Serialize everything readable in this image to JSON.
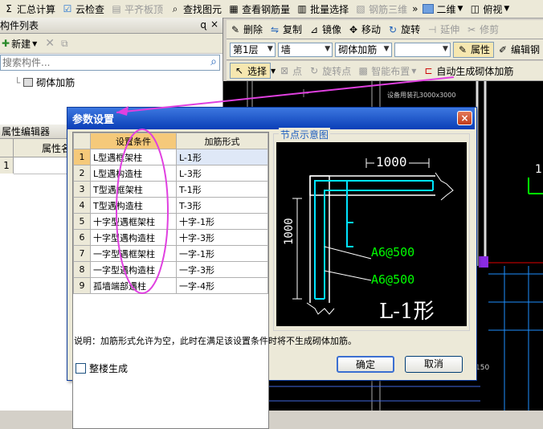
{
  "toolbar1": {
    "items": [
      {
        "label": "汇总计算",
        "icon": "sigma-icon",
        "enabled": true
      },
      {
        "label": "云检查",
        "icon": "cloud-check-icon",
        "enabled": true
      },
      {
        "label": "平齐板顶",
        "icon": "align-slab-icon",
        "enabled": false
      },
      {
        "label": "查找图元",
        "icon": "find-icon",
        "enabled": true
      },
      {
        "label": "查看钢筋量",
        "icon": "rebar-view-icon",
        "enabled": true
      },
      {
        "label": "批量选择",
        "icon": "batch-select-icon",
        "enabled": true
      },
      {
        "label": "钢筋三维",
        "icon": "rebar-3d-icon",
        "enabled": false
      }
    ],
    "view_mode": "二维",
    "view_angle": "俯视"
  },
  "toolbar2": {
    "items": [
      {
        "label": "删除",
        "icon": "delete-icon",
        "enabled": true
      },
      {
        "label": "复制",
        "icon": "copy-icon",
        "enabled": true
      },
      {
        "label": "镜像",
        "icon": "mirror-icon",
        "enabled": true
      },
      {
        "label": "移动",
        "icon": "move-icon",
        "enabled": true
      },
      {
        "label": "旋转",
        "icon": "rotate-icon",
        "enabled": true
      },
      {
        "label": "延伸",
        "icon": "extend-icon",
        "enabled": false
      },
      {
        "label": "修剪",
        "icon": "trim-icon",
        "enabled": false
      }
    ]
  },
  "toolbar3": {
    "floor": "第1层",
    "category": "墙",
    "component": "砌体加筋",
    "empty_combo": "",
    "property_label": "属性",
    "edit_label": "编辑钢"
  },
  "toolbar4": {
    "select_label": "选择",
    "point_label": "点",
    "rotate_point_label": "旋转点",
    "smart_layout_label": "智能布置",
    "auto_gen_label": "自动生成砌体加筋"
  },
  "left_panel": {
    "title": "构件列表",
    "pin": "ɋ",
    "close": "×",
    "new_label": "新建",
    "search_placeholder": "搜索构件...",
    "tree_item": "砌体加筋"
  },
  "prop_panel": {
    "title": "属性编辑器",
    "col_header": "属性名",
    "row_number": "1"
  },
  "cad": {
    "label_text": "设备用装孔3000x3000",
    "right_number": "1",
    "bottom_number": "150"
  },
  "dialog": {
    "title": "参数设置",
    "close": "×",
    "columns": [
      "设置条件",
      "加筋形式"
    ],
    "rows": [
      {
        "n": "1",
        "cond": "L型遇框架柱",
        "form": "L-1形"
      },
      {
        "n": "2",
        "cond": "L型遇构造柱",
        "form": "L-3形"
      },
      {
        "n": "3",
        "cond": "T型遇框架柱",
        "form": "T-1形"
      },
      {
        "n": "4",
        "cond": "T型遇构造柱",
        "form": "T-3形"
      },
      {
        "n": "5",
        "cond": "十字型遇框架柱",
        "form": "十字-1形"
      },
      {
        "n": "6",
        "cond": "十字型遇构造柱",
        "form": "十字-3形"
      },
      {
        "n": "7",
        "cond": "一字型遇框架柱",
        "form": "一字-1形"
      },
      {
        "n": "8",
        "cond": "一字型遇构造柱",
        "form": "一字-3形"
      },
      {
        "n": "9",
        "cond": "孤墙端部遇柱",
        "form": "一字-4形"
      }
    ],
    "preview_title": "节点示意图",
    "diagram": {
      "dim_h": "1000",
      "dim_v": "1000",
      "rebar1": "A6@500",
      "rebar2": "A6@500",
      "shape_name": "L-1形"
    },
    "note": "说明：加筋形式允许为空，此时在满足该设置条件时将不生成砌体加筋。",
    "checkbox_label": "整楼生成",
    "ok": "确定",
    "cancel": "取消"
  },
  "colors": {
    "cad_bg": "#000000",
    "annotation": "#e040e0",
    "dialog_title": "#0a3eb7",
    "diagram_cyan": "#00e5ff",
    "diagram_green": "#00ff00"
  }
}
